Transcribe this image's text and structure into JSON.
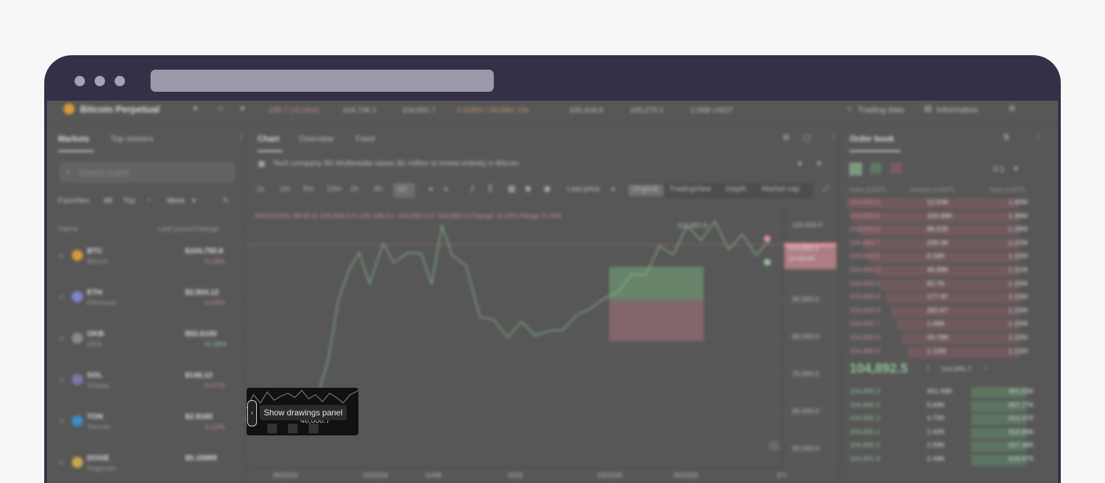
{
  "header": {
    "symbol": "Bitcoin Perpetual",
    "stat1": "-195.7 (-0.18%)",
    "stat2": "104,736.1",
    "stat3": "104,891.7",
    "funding": "0.005% / 05:59m 15s",
    "high": "105,418.8",
    "low": "105,279.1",
    "volume": "2.56B USDT",
    "trading_data": "Trading data",
    "information": "Information"
  },
  "left": {
    "tabs": [
      "Markets",
      "Top movers"
    ],
    "search_placeholder": "Search crypto",
    "filters": [
      "Favorites",
      "All",
      "Top",
      "More"
    ],
    "col_name": "Name",
    "col_price": "Last price/Change",
    "coins": [
      {
        "symbol": "BTC",
        "name": "Bitcoin",
        "price": "$104,750.8",
        "change": "-0.18%",
        "dir": "down",
        "color": "#d59a3a"
      },
      {
        "symbol": "ETH",
        "name": "Ethereum",
        "price": "$2,504.12",
        "change": "-0.05%",
        "dir": "down",
        "color": "#7d86c9"
      },
      {
        "symbol": "OKB",
        "name": "OKB",
        "price": "$52.6100",
        "change": "+0.28%",
        "dir": "up",
        "color": "#8a8a8a"
      },
      {
        "symbol": "SOL",
        "name": "Solana",
        "price": "$146.12",
        "change": "-0.67%",
        "dir": "down",
        "color": "#7a7aa8"
      },
      {
        "symbol": "TON",
        "name": "Toncoin",
        "price": "$2.9160",
        "change": "-1.12%",
        "dir": "down",
        "color": "#3d8ec9"
      },
      {
        "symbol": "DOGE",
        "name": "Dogecoin",
        "price": "$0.16989",
        "change": "",
        "dir": "down",
        "color": "#c9a84c"
      }
    ]
  },
  "chart": {
    "tabs": [
      "Chart",
      "Overview",
      "Feed"
    ],
    "news": "Tech company 9D Multimedia raises $1 million to invest entirely in Bitcoin",
    "intervals": [
      "1s",
      "1m",
      "5m",
      "15m",
      "1h",
      "4h",
      "1D"
    ],
    "price_type": "Last price",
    "views": [
      "Original",
      "TradingView",
      "Depth",
      "Market cap"
    ],
    "ohlc": "06/16/2025, 08:00  O 104,694.0  H 105,180.0  L 104,450.0  C 104,880.0  Change -0.14%  Range 0.74%",
    "high_label": "111,997.0",
    "price_axis": [
      "110,000.0",
      "90,000.0",
      "80,000.0",
      "70,000.0",
      "60,000.0",
      "50,000.0"
    ],
    "price_tag_1": "104,892.5",
    "price_tag_2": "14:03:00",
    "time_axis": [
      "06/2024",
      "10/2024",
      "11/08",
      "2025",
      "03/2025",
      "05/2025",
      "07/"
    ],
    "tooltip": "Show drawings panel",
    "tooltip_value": "46,000.7"
  },
  "book": {
    "title": "Order book",
    "depth": "0.1",
    "cols": [
      "Price (USDT)",
      "Amount (USDT)",
      "Total (USDT)"
    ],
    "asks": [
      [
        "104,894.0",
        "12.54K",
        "1.40M"
      ],
      [
        "104,893.9",
        "104.89K",
        "1.39M"
      ],
      [
        "104,893.8",
        "88.52K",
        "1.28M"
      ],
      [
        "104,893.7",
        "209.3K",
        "1.22M"
      ],
      [
        "104,893.6",
        "8.34K",
        "1.15M"
      ],
      [
        "104,893.3",
        "46.89K",
        "1.21M"
      ],
      [
        "104,893.2",
        "83.7K",
        "1.16M"
      ],
      [
        "104,893.0",
        "177.97",
        "1.15M"
      ],
      [
        "104,892.9",
        "292.67",
        "1.15M"
      ],
      [
        "104,892.7",
        "1.06K",
        "1.15M"
      ],
      [
        "104,892.6",
        "43.79K",
        "1.15M"
      ],
      [
        "104,892.5",
        "1.12M",
        "1.12M"
      ]
    ],
    "last_price": "104,892.5",
    "last_arrow": "↑",
    "mark_price": "104,895.7",
    "bids": [
      [
        "104,892.4",
        "401.93K",
        "401.93K"
      ],
      [
        "104,892.3",
        "5.84K",
        "407.77K"
      ],
      [
        "104,892.2",
        "4.70K",
        "412.47K"
      ],
      [
        "104,892.1",
        "2.42K",
        "414.89K"
      ],
      [
        "104,892.0",
        "2.59K",
        "417.48K"
      ],
      [
        "104,891.9",
        "2.49K",
        "419.97K"
      ]
    ]
  }
}
